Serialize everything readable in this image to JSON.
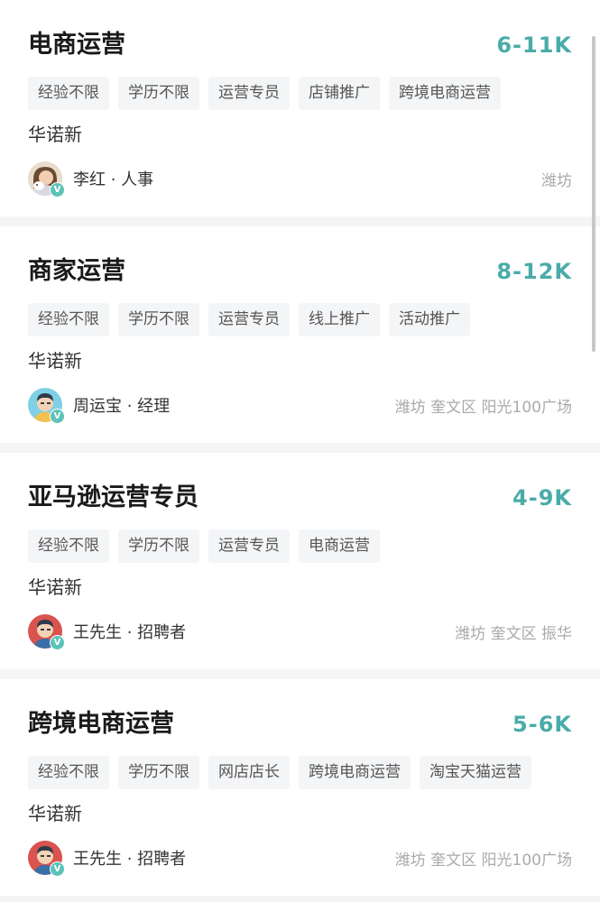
{
  "jobs": [
    {
      "title": "电商运营",
      "salary": "6-11K",
      "tags": [
        "经验不限",
        "学历不限",
        "运营专员",
        "店铺推广",
        "跨境电商运营"
      ],
      "company": "华诺新",
      "recruiter": "李红 · 人事",
      "location": "潍坊",
      "verified": "V",
      "avatar_icon": "female-avatar-icon"
    },
    {
      "title": "商家运营",
      "salary": "8-12K",
      "tags": [
        "经验不限",
        "学历不限",
        "运营专员",
        "线上推广",
        "活动推广"
      ],
      "company": "华诺新",
      "recruiter": "周运宝 · 经理",
      "location": "潍坊  奎文区  阳光100广场",
      "verified": "V",
      "avatar_icon": "male-avatar-icon"
    },
    {
      "title": "亚马逊运营专员",
      "salary": "4-9K",
      "tags": [
        "经验不限",
        "学历不限",
        "运营专员",
        "电商运营"
      ],
      "company": "华诺新",
      "recruiter": "王先生 · 招聘者",
      "location": "潍坊  奎文区  振华",
      "verified": "V",
      "avatar_icon": "male-avatar-icon"
    },
    {
      "title": "跨境电商运营",
      "salary": "5-6K",
      "tags": [
        "经验不限",
        "学历不限",
        "网店店长",
        "跨境电商运营",
        "淘宝天猫运营"
      ],
      "company": "华诺新",
      "recruiter": "王先生 · 招聘者",
      "location": "潍坊  奎文区  阳光100广场",
      "verified": "V",
      "avatar_icon": "male-avatar-icon"
    }
  ],
  "colors": {
    "salary": "#4aaca8",
    "verified_badge": "#5dc3b8",
    "tag_bg": "#f4f5f7"
  }
}
